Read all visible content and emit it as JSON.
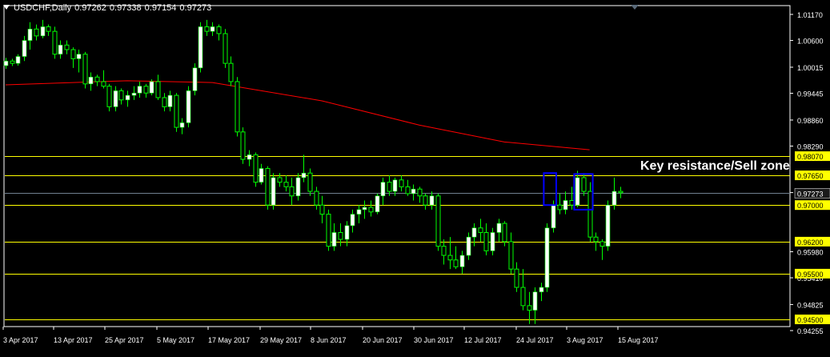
{
  "header": {
    "symbol": "USDCHF,Daily",
    "values": [
      "0.97262",
      "0.97338",
      "0.97154",
      "0.97273"
    ]
  },
  "annotation": "Key resistance/Sell zone",
  "colors": {
    "background": "#000000",
    "bull_candle": "#ffffff",
    "wick": "#00ff00",
    "ma": "#ff0000",
    "level_line": "#ffff00",
    "level_label_bg": "#ffff00",
    "current_price_line": "#708090",
    "box": "#0000ff",
    "axis_text": "#ffffff"
  },
  "chart_data": {
    "type": "candlestick",
    "title": "",
    "xlabel": "",
    "ylabel": "",
    "ylim": [
      0.94255,
      1.0117
    ],
    "y_ticks": [
      "1.01170",
      "1.00600",
      "1.00015",
      "0.99445",
      "0.98860",
      "0.98290",
      "0.97273",
      "0.95980",
      "0.95410",
      "0.94825",
      "0.94255"
    ],
    "x_tick_labels": [
      "3 Apr 2017",
      "13 Apr 2017",
      "25 Apr 2017",
      "5 May 2017",
      "17 May 2017",
      "29 May 2017",
      "8 Jun 2017",
      "20 Jun 2017",
      "30 Jun 2017",
      "12 Jul 2017",
      "24 Jul 2017",
      "3 Aug 2017",
      "15 Aug 2017"
    ],
    "current_price": "0.97273",
    "horizontal_levels": [
      "0.98070",
      "0.97650",
      "0.97000",
      "0.96200",
      "0.95500",
      "0.94500"
    ],
    "ma_series": {
      "points": [
        [
          0,
          0.9963
        ],
        [
          20,
          0.9972
        ],
        [
          34,
          0.9968
        ],
        [
          52,
          0.9928
        ],
        [
          68,
          0.9875
        ],
        [
          82,
          0.9838
        ],
        [
          96,
          0.9821
        ]
      ]
    },
    "boxes": [
      {
        "from": 89,
        "to": 90,
        "low": 0.97,
        "high": 0.977
      },
      {
        "from": 94,
        "to": 96,
        "low": 0.969,
        "high": 0.9768
      }
    ],
    "ohlc": [
      [
        1.0005,
        1.0022,
        0.9998,
        1.0015
      ],
      [
        1.0015,
        1.002,
        1.0004,
        1.001
      ],
      [
        1.001,
        1.003,
        1.0005,
        1.0025
      ],
      [
        1.0025,
        1.007,
        1.0015,
        1.006
      ],
      [
        1.006,
        1.01,
        1.004,
        1.0085
      ],
      [
        1.0085,
        1.0095,
        1.006,
        1.007
      ],
      [
        1.007,
        1.0105,
        1.0065,
        1.009
      ],
      [
        1.009,
        1.0095,
        1.007,
        1.008
      ],
      [
        1.008,
        1.009,
        1.002,
        1.003
      ],
      [
        1.003,
        1.006,
        1.002,
        1.005
      ],
      [
        1.005,
        1.006,
        1.003,
        1.004
      ],
      [
        1.004,
        1.0045,
        1.0,
        1.002
      ],
      [
        1.002,
        1.004,
        0.999,
        1.003
      ],
      [
        1.003,
        1.0035,
        0.9955,
        0.9965
      ],
      [
        0.9965,
        0.999,
        0.995,
        0.998
      ],
      [
        0.998,
        0.9985,
        0.996,
        0.997
      ],
      [
        0.997,
        0.9995,
        0.9955,
        0.996
      ],
      [
        0.996,
        0.9965,
        0.9905,
        0.9915
      ],
      [
        0.9915,
        0.996,
        0.9905,
        0.995
      ],
      [
        0.995,
        0.9955,
        0.992,
        0.993
      ],
      [
        0.993,
        0.995,
        0.9915,
        0.994
      ],
      [
        0.994,
        0.996,
        0.993,
        0.9945
      ],
      [
        0.9945,
        0.997,
        0.9935,
        0.996
      ],
      [
        0.996,
        0.9965,
        0.9935,
        0.9945
      ],
      [
        0.9945,
        0.9975,
        0.994,
        0.997
      ],
      [
        0.997,
        0.9985,
        0.993,
        0.9935
      ],
      [
        0.9935,
        0.9945,
        0.9905,
        0.9915
      ],
      [
        0.9915,
        0.995,
        0.9905,
        0.994
      ],
      [
        0.994,
        0.9945,
        0.986,
        0.987
      ],
      [
        0.987,
        0.989,
        0.9855,
        0.988
      ],
      [
        0.988,
        0.996,
        0.987,
        0.995
      ],
      [
        0.995,
        1.001,
        0.994,
        1.0
      ],
      [
        1.0,
        1.01,
        0.999,
        1.009
      ],
      [
        1.009,
        1.0105,
        1.007,
        1.008
      ],
      [
        1.008,
        1.01,
        1.007,
        1.009
      ],
      [
        1.009,
        1.0095,
        1.006,
        1.0075
      ],
      [
        1.0075,
        1.0085,
        1.0,
        1.001
      ],
      [
        1.001,
        1.0025,
        0.996,
        0.997
      ],
      [
        0.997,
        0.998,
        0.985,
        0.986
      ],
      [
        0.986,
        0.987,
        0.979,
        0.98
      ],
      [
        0.98,
        0.982,
        0.9785,
        0.981
      ],
      [
        0.981,
        0.9815,
        0.974,
        0.975
      ],
      [
        0.975,
        0.979,
        0.9745,
        0.978
      ],
      [
        0.978,
        0.9785,
        0.969,
        0.97
      ],
      [
        0.97,
        0.977,
        0.969,
        0.976
      ],
      [
        0.976,
        0.977,
        0.974,
        0.975
      ],
      [
        0.975,
        0.9765,
        0.973,
        0.974
      ],
      [
        0.974,
        0.976,
        0.97,
        0.972
      ],
      [
        0.972,
        0.977,
        0.971,
        0.976
      ],
      [
        0.976,
        0.981,
        0.975,
        0.977
      ],
      [
        0.977,
        0.978,
        0.972,
        0.973
      ],
      [
        0.973,
        0.974,
        0.969,
        0.97
      ],
      [
        0.97,
        0.972,
        0.966,
        0.968
      ],
      [
        0.968,
        0.969,
        0.96,
        0.961
      ],
      [
        0.961,
        0.966,
        0.96,
        0.964
      ],
      [
        0.964,
        0.966,
        0.961,
        0.9625
      ],
      [
        0.9625,
        0.9665,
        0.961,
        0.9655
      ],
      [
        0.9655,
        0.969,
        0.964,
        0.968
      ],
      [
        0.968,
        0.97,
        0.966,
        0.969
      ],
      [
        0.969,
        0.971,
        0.967,
        0.9695
      ],
      [
        0.9695,
        0.971,
        0.9675,
        0.9685
      ],
      [
        0.9685,
        0.9725,
        0.968,
        0.972
      ],
      [
        0.972,
        0.976,
        0.97,
        0.975
      ],
      [
        0.975,
        0.9765,
        0.972,
        0.973
      ],
      [
        0.973,
        0.976,
        0.972,
        0.9755
      ],
      [
        0.9755,
        0.9765,
        0.973,
        0.974
      ],
      [
        0.974,
        0.9755,
        0.972,
        0.9725
      ],
      [
        0.9725,
        0.9745,
        0.971,
        0.9735
      ],
      [
        0.9735,
        0.974,
        0.9705,
        0.972
      ],
      [
        0.972,
        0.9725,
        0.969,
        0.97
      ],
      [
        0.97,
        0.973,
        0.969,
        0.972
      ],
      [
        0.972,
        0.9725,
        0.96,
        0.961
      ],
      [
        0.961,
        0.9625,
        0.957,
        0.959
      ],
      [
        0.959,
        0.963,
        0.956,
        0.958
      ],
      [
        0.958,
        0.961,
        0.956,
        0.9565
      ],
      [
        0.9565,
        0.96,
        0.955,
        0.959
      ],
      [
        0.959,
        0.964,
        0.958,
        0.963
      ],
      [
        0.963,
        0.966,
        0.961,
        0.965
      ],
      [
        0.965,
        0.967,
        0.962,
        0.964
      ],
      [
        0.964,
        0.966,
        0.959,
        0.96
      ],
      [
        0.96,
        0.965,
        0.959,
        0.964
      ],
      [
        0.964,
        0.967,
        0.962,
        0.966
      ],
      [
        0.966,
        0.9665,
        0.961,
        0.962
      ],
      [
        0.962,
        0.964,
        0.955,
        0.956
      ],
      [
        0.956,
        0.9575,
        0.951,
        0.952
      ],
      [
        0.952,
        0.956,
        0.947,
        0.948
      ],
      [
        0.948,
        0.951,
        0.944,
        0.947
      ],
      [
        0.947,
        0.952,
        0.944,
        0.951
      ],
      [
        0.951,
        0.953,
        0.949,
        0.952
      ],
      [
        0.952,
        0.966,
        0.951,
        0.965
      ],
      [
        0.965,
        0.971,
        0.964,
        0.97
      ],
      [
        0.97,
        0.9725,
        0.968,
        0.969
      ],
      [
        0.969,
        0.973,
        0.968,
        0.971
      ],
      [
        0.971,
        0.974,
        0.969,
        0.97
      ],
      [
        0.97,
        0.9775,
        0.9695,
        0.976
      ],
      [
        0.976,
        0.977,
        0.972,
        0.973
      ],
      [
        0.973,
        0.975,
        0.962,
        0.963
      ],
      [
        0.963,
        0.964,
        0.96,
        0.962
      ],
      [
        0.962,
        0.9625,
        0.958,
        0.961
      ],
      [
        0.961,
        0.971,
        0.96,
        0.97
      ],
      [
        0.97,
        0.976,
        0.969,
        0.973
      ],
      [
        0.973,
        0.974,
        0.9715,
        0.9727
      ]
    ]
  }
}
